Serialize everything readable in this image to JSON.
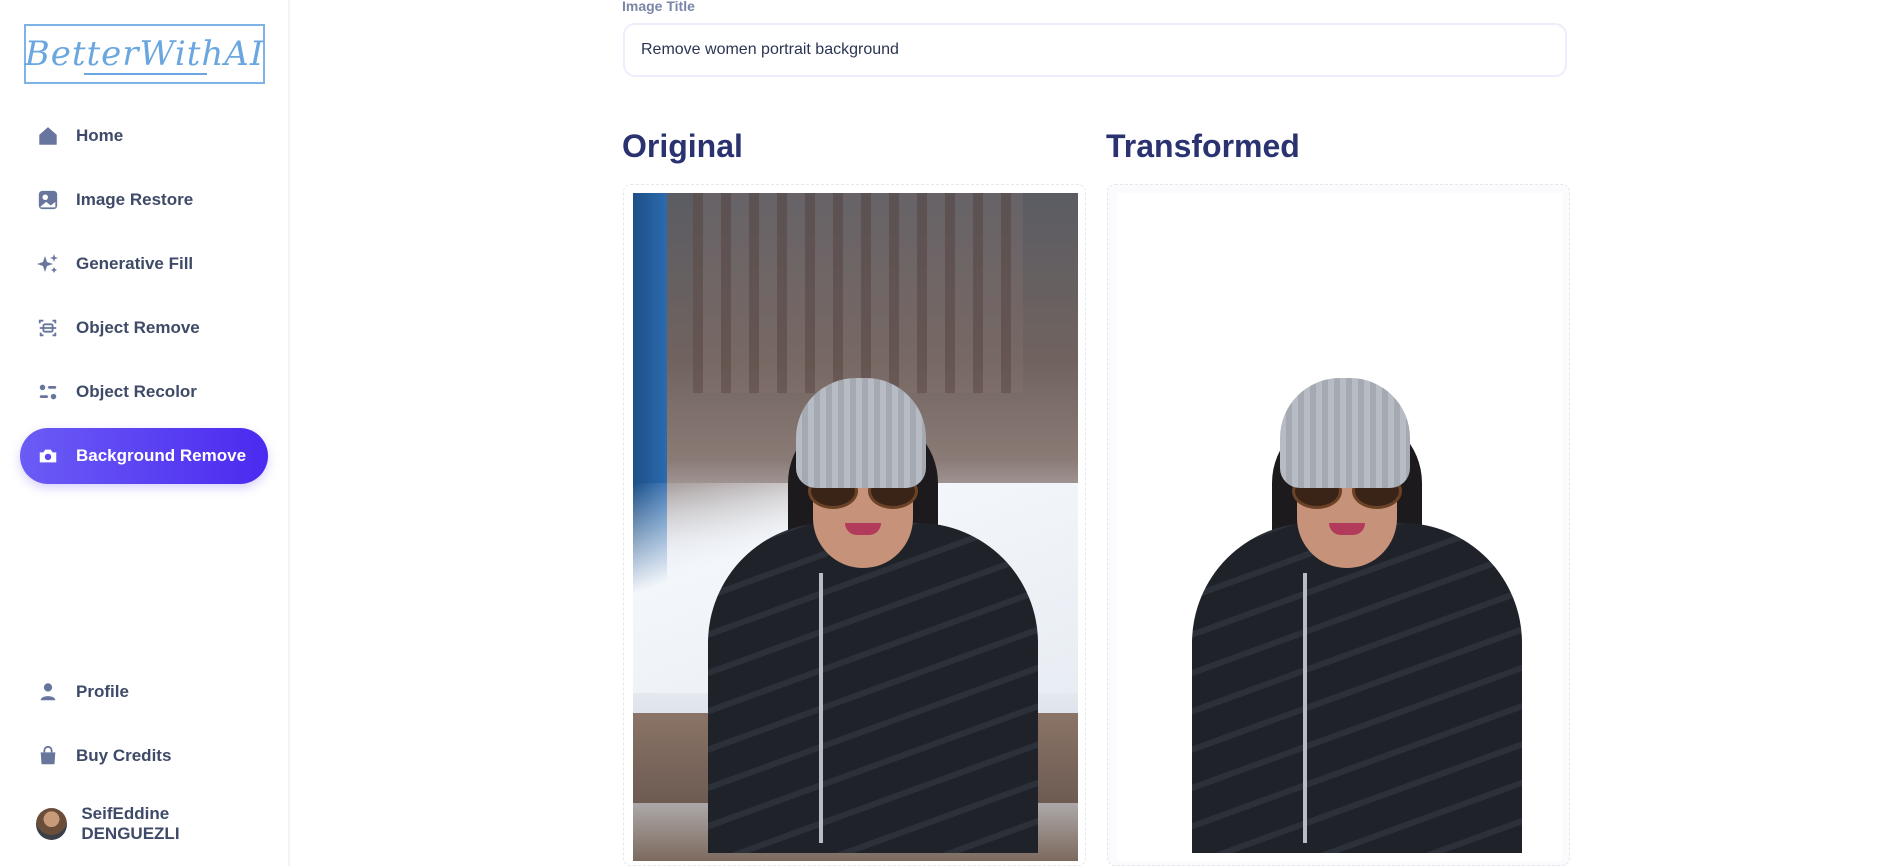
{
  "sidebar": {
    "logo_text": "BetterWithAI",
    "nav": [
      {
        "label": "Home",
        "icon": "home-icon"
      },
      {
        "label": "Image Restore",
        "icon": "image-icon"
      },
      {
        "label": "Generative Fill",
        "icon": "sparkles-icon"
      },
      {
        "label": "Object Remove",
        "icon": "scan-icon"
      },
      {
        "label": "Object Recolor",
        "icon": "filter-icon"
      },
      {
        "label": "Background Remove",
        "icon": "camera-icon",
        "active": true
      }
    ],
    "bottom": [
      {
        "label": "Profile",
        "icon": "user-icon"
      },
      {
        "label": "Buy Credits",
        "icon": "bag-icon"
      }
    ],
    "user_name": "SeifEddine DENGUEZLI"
  },
  "form": {
    "title_label": "Image Title",
    "title_value": "Remove women portrait background"
  },
  "panels": {
    "original_heading": "Original",
    "transformed_heading": "Transformed"
  },
  "colors": {
    "accent_start": "#6b5cf5",
    "accent_end": "#4b2af0",
    "heading": "#2a3270",
    "icon": "#68759c"
  }
}
